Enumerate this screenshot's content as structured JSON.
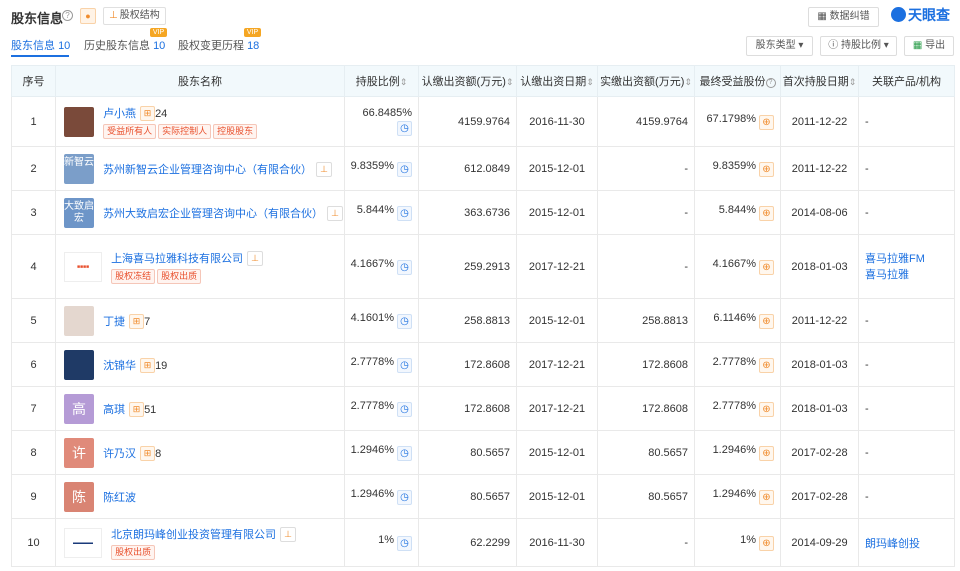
{
  "header": {
    "title": "股东信息",
    "equity_structure": "股权结构",
    "report_error": "数据纠错",
    "brand": "天眼查"
  },
  "tabs": [
    {
      "label": "股东信息",
      "count": "10",
      "vip": ""
    },
    {
      "label": "历史股东信息",
      "count": "10",
      "vip": "VIP"
    },
    {
      "label": "股权变更历程",
      "count": "18",
      "vip": "VIP"
    }
  ],
  "controls": {
    "shareholder_type": "股东类型",
    "holding_ratio": "持股比例",
    "export": "导出"
  },
  "columns": [
    "序号",
    "股东名称",
    "持股比例",
    "认缴出资额(万元)",
    "认缴出资日期",
    "实缴出资额(万元)",
    "最终受益股份",
    "首次持股日期",
    "关联产品/机构"
  ],
  "rows": [
    {
      "no": "1",
      "name": "卢小燕",
      "avatar": "",
      "count": "24",
      "tags": [
        "受益所有人",
        "实际控制人",
        "控股股东"
      ],
      "ratio": "66.8485%",
      "subscribed": "4159.9764",
      "sub_date": "2016-11-30",
      "paid": "4159.9764",
      "benefit": "67.1798%",
      "first_date": "2011-12-22",
      "related": [
        "-"
      ]
    },
    {
      "no": "2",
      "name": "苏州新智云企业管理咨询中心（有限合伙）",
      "avatar": "新智云",
      "count": "",
      "tags": [],
      "ratio": "9.8359%",
      "subscribed": "612.0849",
      "sub_date": "2015-12-01",
      "paid": "-",
      "benefit": "9.8359%",
      "first_date": "2011-12-22",
      "related": [
        "-"
      ]
    },
    {
      "no": "3",
      "name": "苏州大致启宏企业管理咨询中心（有限合伙）",
      "avatar": "大致启宏",
      "count": "",
      "tags": [],
      "ratio": "5.844%",
      "subscribed": "363.6736",
      "sub_date": "2015-12-01",
      "paid": "-",
      "benefit": "5.844%",
      "first_date": "2014-08-06",
      "related": [
        "-"
      ]
    },
    {
      "no": "4",
      "name": "上海喜马拉雅科技有限公司",
      "avatar": "",
      "count": "",
      "tags": [
        "股权冻结",
        "股权出质"
      ],
      "ratio": "4.1667%",
      "subscribed": "259.2913",
      "sub_date": "2017-12-21",
      "paid": "-",
      "benefit": "4.1667%",
      "first_date": "2018-01-03",
      "related": [
        "喜马拉雅FM",
        "喜马拉雅"
      ]
    },
    {
      "no": "5",
      "name": "丁捷",
      "avatar": "",
      "count": "7",
      "tags": [],
      "ratio": "4.1601%",
      "subscribed": "258.8813",
      "sub_date": "2015-12-01",
      "paid": "258.8813",
      "benefit": "6.1146%",
      "first_date": "2011-12-22",
      "related": [
        "-"
      ]
    },
    {
      "no": "6",
      "name": "沈锦华",
      "avatar": "",
      "count": "19",
      "tags": [],
      "ratio": "2.7778%",
      "subscribed": "172.8608",
      "sub_date": "2017-12-21",
      "paid": "172.8608",
      "benefit": "2.7778%",
      "first_date": "2018-01-03",
      "related": [
        "-"
      ]
    },
    {
      "no": "7",
      "name": "高琪",
      "avatar": "高",
      "count": "51",
      "tags": [],
      "ratio": "2.7778%",
      "subscribed": "172.8608",
      "sub_date": "2017-12-21",
      "paid": "172.8608",
      "benefit": "2.7778%",
      "first_date": "2018-01-03",
      "related": [
        "-"
      ]
    },
    {
      "no": "8",
      "name": "许乃汉",
      "avatar": "许",
      "count": "8",
      "tags": [],
      "ratio": "1.2946%",
      "subscribed": "80.5657",
      "sub_date": "2015-12-01",
      "paid": "80.5657",
      "benefit": "1.2946%",
      "first_date": "2017-02-28",
      "related": [
        "-"
      ]
    },
    {
      "no": "9",
      "name": "陈红波",
      "avatar": "陈",
      "count": "",
      "tags": [],
      "ratio": "1.2946%",
      "subscribed": "80.5657",
      "sub_date": "2015-12-01",
      "paid": "80.5657",
      "benefit": "1.2946%",
      "first_date": "2017-02-28",
      "related": [
        "-"
      ]
    },
    {
      "no": "10",
      "name": "北京朗玛峰创业投资管理有限公司",
      "avatar": "",
      "count": "",
      "tags": [
        "股权出质"
      ],
      "ratio": "1%",
      "subscribed": "62.2299",
      "sub_date": "2016-11-30",
      "paid": "-",
      "benefit": "1%",
      "first_date": "2014-09-29",
      "related": [
        "朗玛峰创投"
      ]
    }
  ]
}
